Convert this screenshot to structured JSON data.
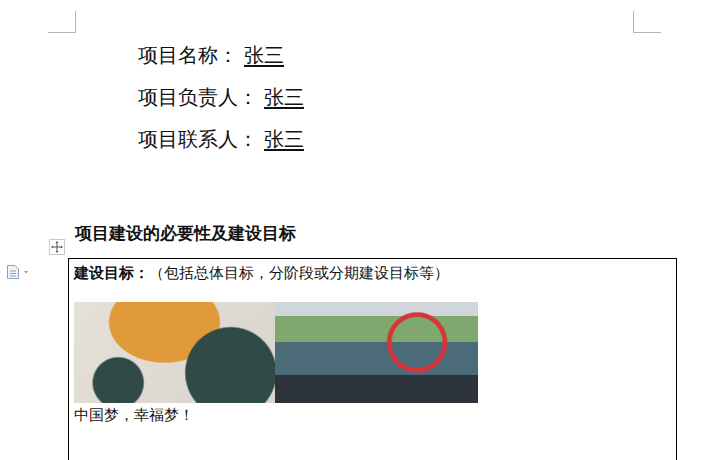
{
  "fields": [
    {
      "label": "项目名称：",
      "value": "张三"
    },
    {
      "label": "项目负责人：",
      "value": "张三"
    },
    {
      "label": "项目联系人：",
      "value": "张三"
    }
  ],
  "section_heading": "项目建设的必要性及建设目标",
  "cell": {
    "label": "建设目标：",
    "hint": "（包括总体目标，分阶段或分期建设目标等）",
    "caption": "中国梦，幸福梦！"
  }
}
